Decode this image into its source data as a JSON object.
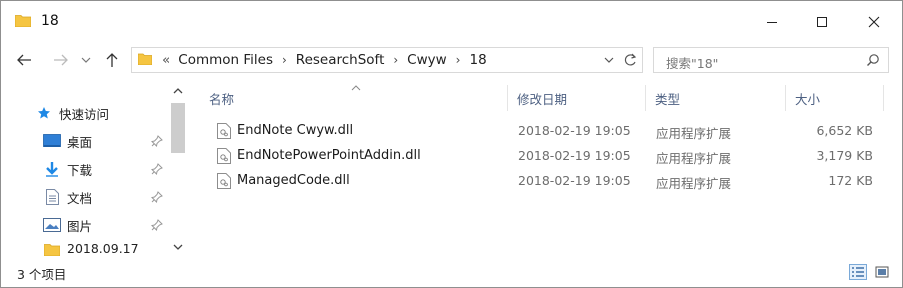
{
  "window": {
    "title": "18",
    "minimize_icon": "minimize-icon",
    "maximize_icon": "maximize-icon",
    "close_icon": "close-icon"
  },
  "navigation": {
    "back_icon": "arrow-left-icon",
    "forward_icon": "arrow-right-icon",
    "recent_icon": "chevron-down-icon",
    "up_icon": "arrow-up-icon"
  },
  "address": {
    "lead": "«",
    "crumbs": [
      "Common Files",
      "ResearchSoft",
      "Cwyw",
      "18"
    ],
    "separator": "›",
    "refresh_icon": "refresh-icon",
    "dropdown_icon": "chevron-down-icon"
  },
  "search": {
    "placeholder": "搜索\"18\""
  },
  "sidebar": {
    "items": [
      {
        "label": "快速访问",
        "icon": "star-icon",
        "pinned": false
      },
      {
        "label": "桌面",
        "icon": "desktop-icon",
        "pinned": true
      },
      {
        "label": "下载",
        "icon": "download-icon",
        "pinned": true
      },
      {
        "label": "文档",
        "icon": "document-icon",
        "pinned": true
      },
      {
        "label": "图片",
        "icon": "pictures-icon",
        "pinned": true
      },
      {
        "label": "2018.09.17",
        "icon": "folder-icon",
        "pinned": false
      }
    ]
  },
  "columns": {
    "name": "名称",
    "date": "修改日期",
    "type": "类型",
    "size": "大小"
  },
  "files": [
    {
      "name": "EndNote Cwyw.dll",
      "date": "2018-02-19 19:05",
      "type": "应用程序扩展",
      "size": "6,652 KB"
    },
    {
      "name": "EndNotePowerPointAddin.dll",
      "date": "2018-02-19 19:05",
      "type": "应用程序扩展",
      "size": "3,179 KB"
    },
    {
      "name": "ManagedCode.dll",
      "date": "2018-02-19 19:05",
      "type": "应用程序扩展",
      "size": "172 KB"
    }
  ],
  "status": {
    "item_count": "3 个项目"
  },
  "colors": {
    "accent": "#0078d7",
    "folder": "#f5c542",
    "header_text": "#4d6082"
  }
}
